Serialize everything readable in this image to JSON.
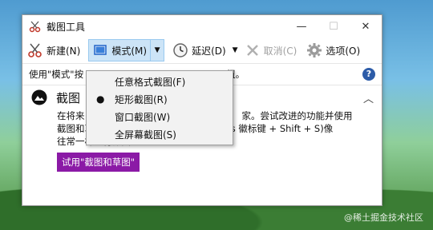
{
  "window": {
    "title": "截图工具"
  },
  "toolbar": {
    "new_label": "新建(N)",
    "mode_label": "模式(M)",
    "delay_label": "延迟(D)",
    "cancel_label": "取消(C)",
    "options_label": "选项(O)"
  },
  "infobar": {
    "text_left": "使用\"模式\"按",
    "text_right": "纽。"
  },
  "mode_menu": {
    "items": [
      {
        "label": "任意格式截图(F)",
        "selected": false
      },
      {
        "label": "矩形截图(R)",
        "selected": true
      },
      {
        "label": "窗口截图(W)",
        "selected": false
      },
      {
        "label": "全屏幕截图(S)",
        "selected": false
      }
    ]
  },
  "promo": {
    "title": "截图",
    "line1_left": "在将来",
    "line1_right": "家。尝试改进的功能并使用",
    "line2": "截图和草图(&S)(或尝试快捷方式 Windows 徽标键 + Shift + S)像",
    "line3": "往常一样进行截图。",
    "button_label": "试用\"截图和草图\""
  },
  "watermark": "@稀土掘金技术社区",
  "colors": {
    "accent": "#2d5ca8",
    "promo_button": "#8b1aa6",
    "active_bg": "#cce4f7"
  }
}
